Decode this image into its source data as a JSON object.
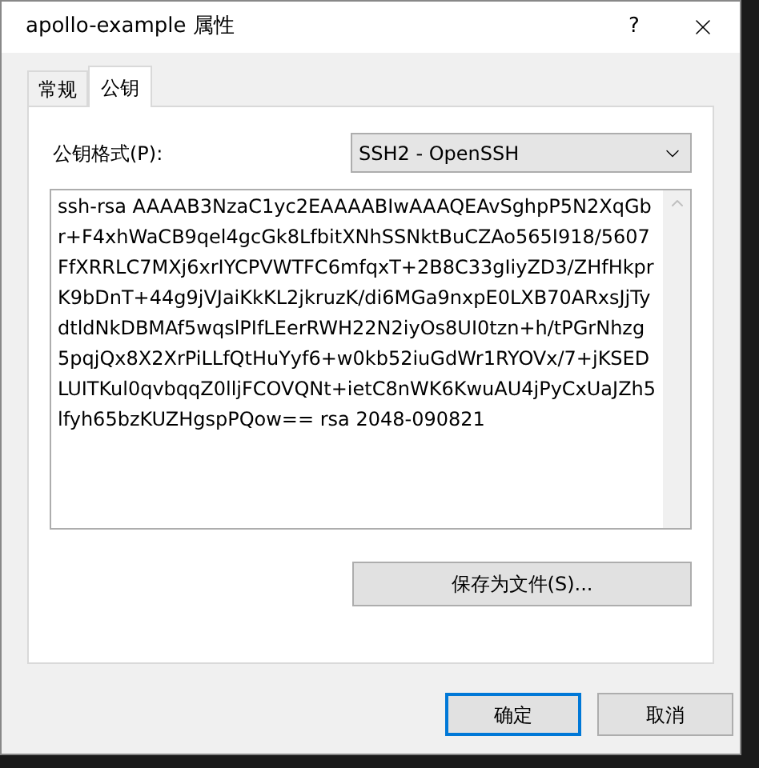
{
  "window": {
    "title": "apollo-example 属性",
    "help": "?"
  },
  "tabs": [
    {
      "label": "常规",
      "selected": false
    },
    {
      "label": "公钥",
      "selected": true
    }
  ],
  "format": {
    "label": "公钥格式(P):",
    "value": "SSH2 - OpenSSH"
  },
  "key_text": "ssh-rsa AAAAB3NzaC1yc2EAAAABIwAAAQEAvSghpP5N2XqGbr+F4xhWaCB9qel4gcGk8LfbitXNhSSNktBuCZAo565I918/5607FfXRRLC7MXj6xrIYCPVWTFC6mfqxT+2B8C33gIiyZD3/ZHfHkprK9bDnT+44g9jVJaiKkKL2jkruzK/di6MGa9nxpE0LXB70ARxsJjTydtldNkDBMAf5wqslPIfLEerRWH22N2iyOs8UI0tzn+h/tPGrNhzg5pqjQx8X2XrPiLLfQtHuYyf6+w0kb52iuGdWr1RYOVx/7+jKSEDLUITKul0qvbqqZ0lljFCOVQNt+ietC8nWK6KwuAU4jPyCxUaJZh5lfyh65bzKUZHgspPQow== rsa 2048-090821",
  "save_button": "保存为文件(S)...",
  "buttons": [
    {
      "label": "确定",
      "default": true
    },
    {
      "label": "取消",
      "default": false
    }
  ]
}
